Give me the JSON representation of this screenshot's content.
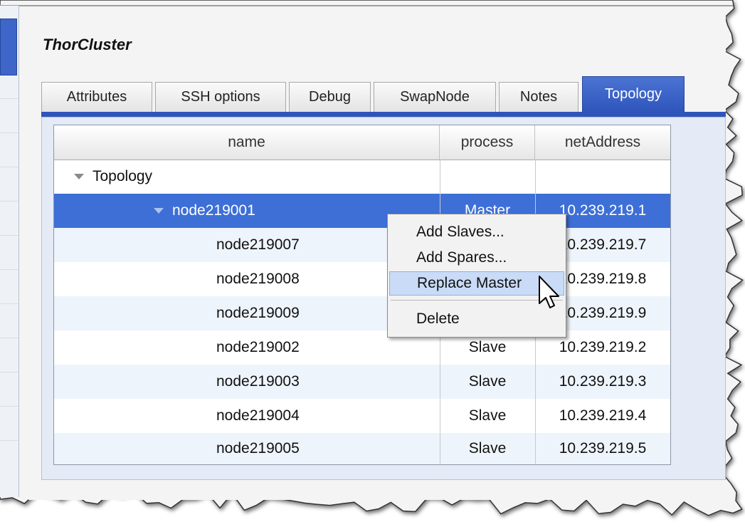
{
  "window": {
    "title": "ThorCluster"
  },
  "tabs": [
    {
      "label": "Attributes"
    },
    {
      "label": "SSH options"
    },
    {
      "label": "Debug"
    },
    {
      "label": "SwapNode"
    },
    {
      "label": "Notes"
    },
    {
      "label": "Topology",
      "active": true
    }
  ],
  "table": {
    "columns": [
      "name",
      "process",
      "netAddress"
    ],
    "rows": [
      {
        "name": "Topology",
        "process": "",
        "netAddress": ""
      },
      {
        "name": "node219001",
        "process": "Master",
        "netAddress": "10.239.219.1"
      },
      {
        "name": "node219007",
        "process": "",
        "netAddress": "10.239.219.7"
      },
      {
        "name": "node219008",
        "process": "",
        "netAddress": "10.239.219.8"
      },
      {
        "name": "node219009",
        "process": "",
        "netAddress": "10.239.219.9"
      },
      {
        "name": "node219002",
        "process": "Slave",
        "netAddress": "10.239.219.2"
      },
      {
        "name": "node219003",
        "process": "Slave",
        "netAddress": "10.239.219.3"
      },
      {
        "name": "node219004",
        "process": "Slave",
        "netAddress": "10.239.219.4"
      },
      {
        "name": "node219005",
        "process": "Slave",
        "netAddress": "10.239.219.5"
      }
    ]
  },
  "context_menu": {
    "items": [
      "Add Slaves...",
      "Add Spares...",
      "Replace Master",
      "Delete"
    ],
    "hovered": "Replace Master"
  },
  "icons": {
    "expand": "triangle-down-icon",
    "cursor": "arrow-cursor-icon"
  },
  "colors": {
    "selection": "#3d6fd6",
    "active_tab": "#2f55bb",
    "menu_hover": "#c9dbf6",
    "content_bg": "#e4ebf7"
  }
}
